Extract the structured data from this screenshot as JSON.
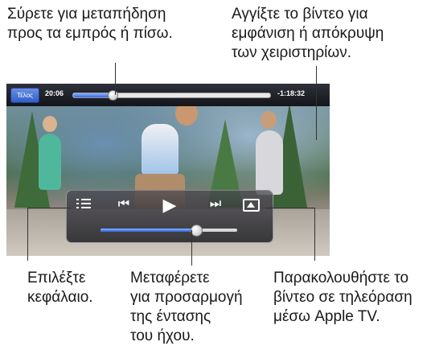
{
  "callouts": {
    "scrub": [
      "Σύρετε για μεταπήδηση",
      "προς τα εμπρός ή πίσω."
    ],
    "tap": [
      "Αγγίξτε το βίντεο για",
      "εμφάνιση ή απόκρυψη",
      "των χειριστηρίων."
    ],
    "chapter": [
      "Επιλέξτε",
      "κεφάλαιο."
    ],
    "volume": [
      "Μεταφέρετε",
      "για προσαρμογή",
      "της έντασης",
      "του ήχου."
    ],
    "airplay": [
      "Παρακολουθήστε το",
      "βίντεο σε τηλεόραση",
      "μέσω Apple TV."
    ]
  },
  "player": {
    "done_label": "Τέλος",
    "elapsed": "20:06",
    "remaining": "-1:18:32",
    "playback_progress": 0.2
  },
  "controls": {
    "icons": {
      "chapters": "chapter-list-icon",
      "prev": "skip-back-icon",
      "play": "play-icon",
      "next": "skip-forward-icon",
      "airplay": "airplay-icon"
    },
    "volume_level": 0.7,
    "accent": "#2f68e6"
  }
}
